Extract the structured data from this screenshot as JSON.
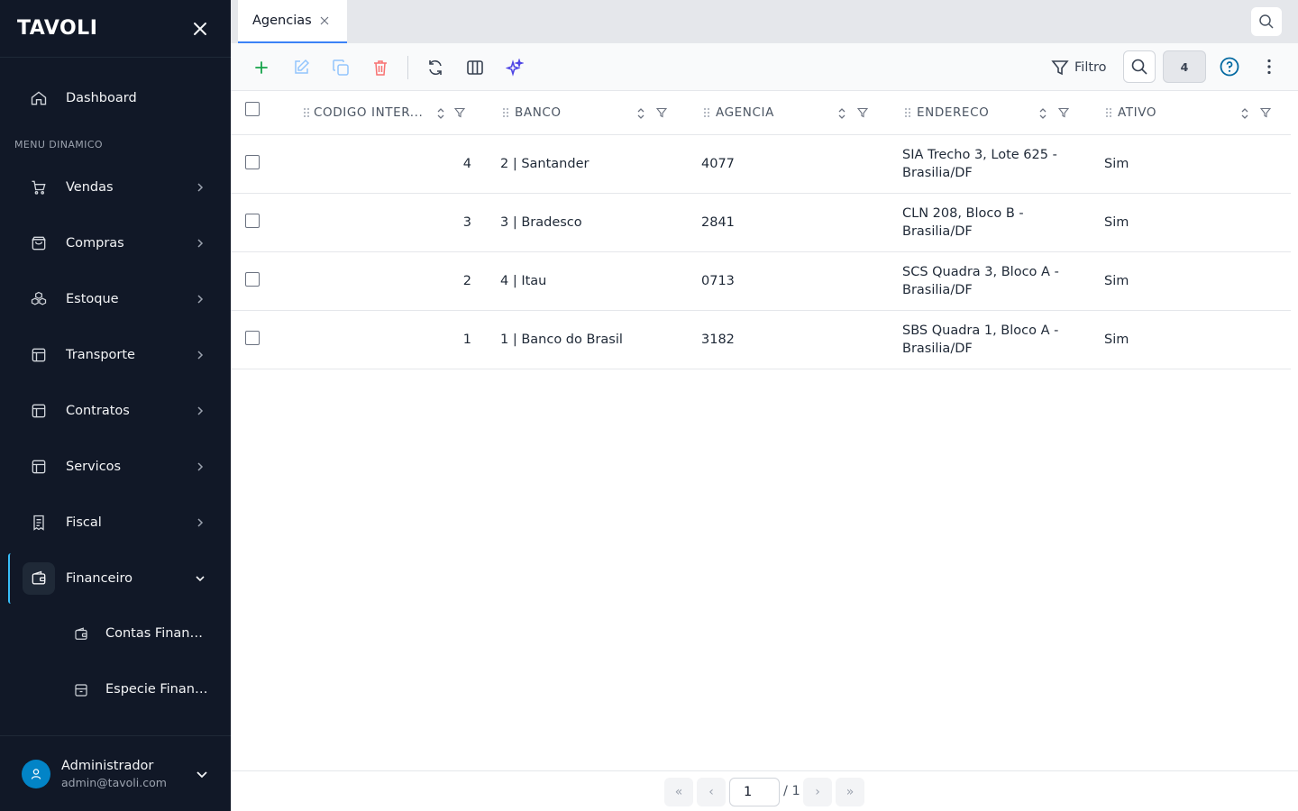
{
  "app": {
    "logo": "TAVOLI"
  },
  "sidebar": {
    "dashboard_label": "Dashboard",
    "section_label": "MENU DINAMICO",
    "items": [
      {
        "label": "Vendas",
        "icon": "cart-icon"
      },
      {
        "label": "Compras",
        "icon": "shopping-bag-icon"
      },
      {
        "label": "Estoque",
        "icon": "boxes-icon"
      },
      {
        "label": "Transporte",
        "icon": "table-icon"
      },
      {
        "label": "Contratos",
        "icon": "table-icon"
      },
      {
        "label": "Servicos",
        "icon": "table-icon"
      },
      {
        "label": "Fiscal",
        "icon": "receipt-icon"
      },
      {
        "label": "Financeiro",
        "icon": "wallet-icon",
        "expanded": true
      }
    ],
    "subitems": [
      {
        "label": "Contas Financeiras",
        "icon": "wallet-icon"
      },
      {
        "label": "Especie Financeira",
        "icon": "archive-icon"
      }
    ],
    "user": {
      "name": "Administrador",
      "email": "admin@tavoli.com"
    }
  },
  "tabs": [
    {
      "label": "Agencias",
      "active": true
    }
  ],
  "toolbar": {
    "filter_label": "Filtro",
    "count": "4"
  },
  "table": {
    "columns": [
      {
        "label": "CODIGO INTER..."
      },
      {
        "label": "BANCO"
      },
      {
        "label": "AGENCIA"
      },
      {
        "label": "ENDERECO"
      },
      {
        "label": "ATIVO"
      }
    ],
    "rows": [
      {
        "codigo": "4",
        "banco": "2 | Santander",
        "agencia": "4077",
        "endereco": "SIA Trecho 3, Lote 625 - Brasilia/DF",
        "ativo": "Sim"
      },
      {
        "codigo": "3",
        "banco": "3 | Bradesco",
        "agencia": "2841",
        "endereco": "CLN 208, Bloco B - Brasilia/DF",
        "ativo": "Sim"
      },
      {
        "codigo": "2",
        "banco": "4 | Itau",
        "agencia": "0713",
        "endereco": "SCS Quadra 3, Bloco A - Brasilia/DF",
        "ativo": "Sim"
      },
      {
        "codigo": "1",
        "banco": "1 | Banco do Brasil",
        "agencia": "3182",
        "endereco": "SBS Quadra 1, Bloco A - Brasilia/DF",
        "ativo": "Sim"
      }
    ]
  },
  "pagination": {
    "first": "«",
    "prev": "‹",
    "next": "›",
    "last": "»",
    "current_page": "1",
    "total": "/ 1"
  },
  "colors": {
    "sidebar_bg": "#111827",
    "accent": "#3b82f6",
    "add": "#16a34a",
    "delete": "#ef4444",
    "ai": "#4f46e5",
    "help": "#0369a1"
  }
}
